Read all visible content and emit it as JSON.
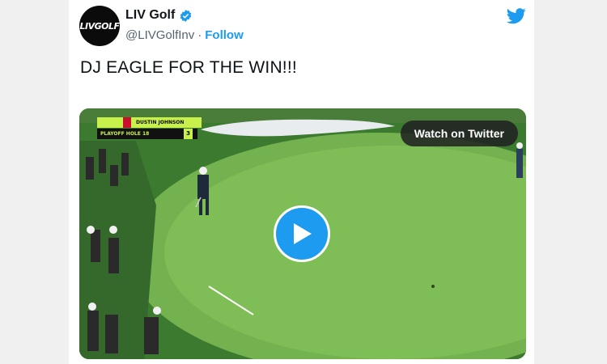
{
  "account": {
    "avatar_text": "LIVGOLF",
    "display_name": "LIV Golf",
    "handle": "@LIVGolfInv",
    "separator": "·",
    "follow_label": "Follow",
    "verified": true
  },
  "tweet": {
    "text": "DJ EAGLE FOR THE WIN!!!"
  },
  "video": {
    "watch_label": "Watch on Twitter",
    "scorebug": {
      "player": "DUSTIN JOHNSON",
      "hole": "PLAYOFF HOLE 18",
      "score": "3"
    }
  },
  "colors": {
    "brand_blue": "#1d9bf0",
    "text_primary": "#0f1419",
    "text_secondary": "#536471",
    "scorebug_accent": "#c8f04a"
  },
  "icons": {
    "verified": "verified-badge-icon",
    "brand": "twitter-bird-icon",
    "play": "play-icon"
  }
}
